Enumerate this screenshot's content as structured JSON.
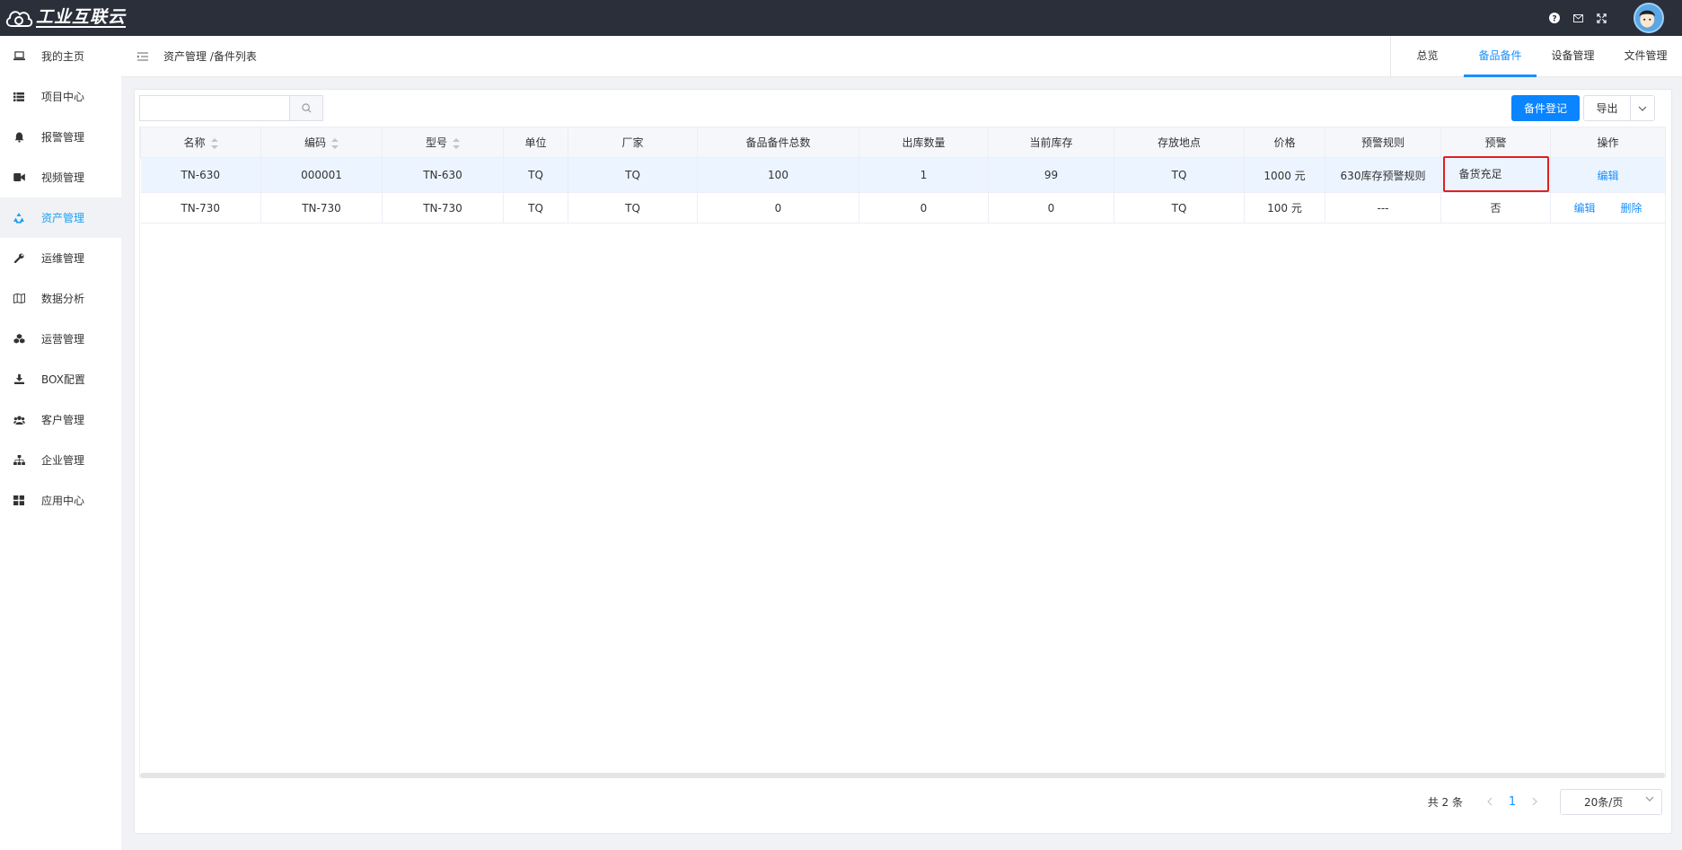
{
  "app": {
    "logo_text": "工业互联云"
  },
  "sidebar": {
    "items": [
      {
        "label": "我的主页",
        "icon": "laptop-icon"
      },
      {
        "label": "项目中心",
        "icon": "list-icon"
      },
      {
        "label": "报警管理",
        "icon": "bell-icon"
      },
      {
        "label": "视频管理",
        "icon": "video-icon"
      },
      {
        "label": "资产管理",
        "icon": "recycle-icon",
        "active": true
      },
      {
        "label": "运维管理",
        "icon": "wrench-icon"
      },
      {
        "label": "数据分析",
        "icon": "map-icon"
      },
      {
        "label": "运营管理",
        "icon": "cubes-icon"
      },
      {
        "label": "BOX配置",
        "icon": "download-icon"
      },
      {
        "label": "客户管理",
        "icon": "users-icon"
      },
      {
        "label": "企业管理",
        "icon": "sitemap-icon"
      },
      {
        "label": "应用中心",
        "icon": "grid-icon"
      }
    ]
  },
  "header": {
    "breadcrumb": "资产管理 /备件列表",
    "tabs": [
      {
        "label": "总览"
      },
      {
        "label": "备品备件",
        "active": true
      },
      {
        "label": "设备管理"
      },
      {
        "label": "文件管理"
      }
    ]
  },
  "toolbar": {
    "search_placeholder": "",
    "register_button": "备件登记",
    "export_button": "导出"
  },
  "table": {
    "columns": [
      "名称",
      "编码",
      "型号",
      "单位",
      "厂家",
      "备品备件总数",
      "出库数量",
      "当前库存",
      "存放地点",
      "价格",
      "预警规则",
      "预警",
      "操作"
    ],
    "rows": [
      {
        "name": "TN-630",
        "code": "000001",
        "model": "TN-630",
        "unit": "TQ",
        "vendor": "TQ",
        "total": "100",
        "out": "1",
        "stock": "99",
        "location": "TQ",
        "price": "1000 元",
        "rule": "630库存预警规则",
        "warn": "备货充足",
        "op_edit": "编辑"
      },
      {
        "name": "TN-730",
        "code": "TN-730",
        "model": "TN-730",
        "unit": "TQ",
        "vendor": "TQ",
        "total": "0",
        "out": "0",
        "stock": "0",
        "location": "TQ",
        "price": "100 元",
        "rule": "---",
        "warn": "否",
        "op_edit": "编辑",
        "op_delete": "删除"
      }
    ]
  },
  "pagination": {
    "total": "共 2 条",
    "current": "1",
    "page_size": "20条/页"
  },
  "colors": {
    "primary": "#0a84ff",
    "topbar": "#2b2f3a",
    "sidebar_active": "#1da1f2",
    "highlight_border": "#e02020"
  }
}
